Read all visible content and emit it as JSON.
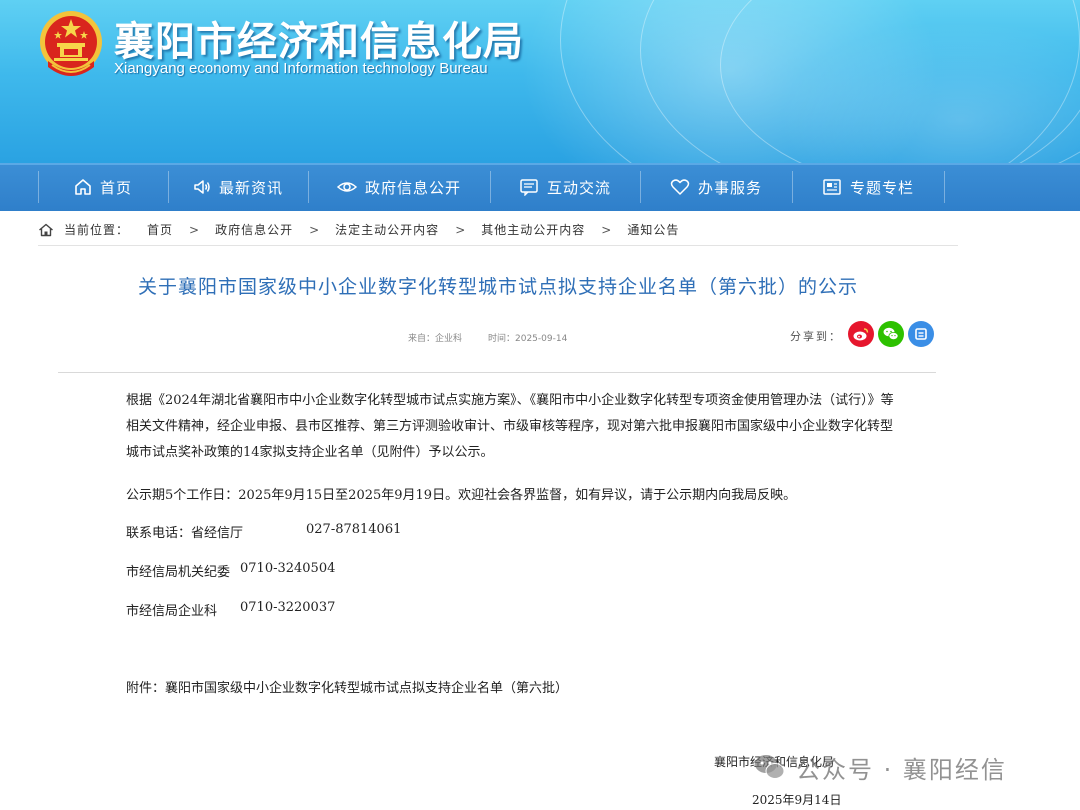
{
  "header": {
    "title": "襄阳市经济和信息化局",
    "subtitle": "Xiangyang economy and Information technology Bureau"
  },
  "nav": [
    {
      "label": "首页",
      "icon": "home-icon"
    },
    {
      "label": "最新资讯",
      "icon": "speaker-icon"
    },
    {
      "label": "政府信息公开",
      "icon": "eye-icon"
    },
    {
      "label": "互动交流",
      "icon": "message-icon"
    },
    {
      "label": "办事服务",
      "icon": "heart-icon"
    },
    {
      "label": "专题专栏",
      "icon": "newspaper-icon"
    }
  ],
  "breadcrumb": {
    "prefix": "当前位置：",
    "items": [
      "首页",
      "政府信息公开",
      "法定主动公开内容",
      "其他主动公开内容",
      "通知公告"
    ],
    "separator": ">"
  },
  "article": {
    "title": "关于襄阳市国家级中小企业数字化转型城市试点拟支持企业名单（第六批）的公示",
    "source": "来自：企业科",
    "time": "时间：2025-09-14",
    "share_label": "分享到：",
    "share_icons": [
      "weibo-icon",
      "wechat-icon",
      "qzone-icon"
    ],
    "paragraph": "根据《2024年湖北省襄阳市中小企业数字化转型城市试点实施方案》、《襄阳市中小企业数字化转型专项资金使用管理办法（试行）》等相关文件精神，经企业申报、县市区推荐、第三方评测验收审计、市级审核等程序，现对第六批申报襄阳市国家级中小企业数字化转型城市试点奖补政策的14家拟支持企业名单（见附件）予以公示。",
    "period": "公示期5个工作日：2025年9月15日至2025年9月19日。欢迎社会各界监督，如有异议，请于公示期内向我局反映。",
    "contacts": [
      {
        "label": "联系电话：省经信厅",
        "phone": "027-87814061"
      },
      {
        "label": "市经信局机关纪委",
        "phone": "0710-3240504"
      },
      {
        "label": "市经信局企业科",
        "phone": "0710-3220037"
      }
    ],
    "attachment": "附件：襄阳市国家级中小企业数字化转型城市试点拟支持企业名单（第六批）",
    "signature": "襄阳市经济和信息化局",
    "date": "2025年9月14日"
  },
  "watermark": {
    "text": "公众号 · 襄阳经信"
  },
  "colors": {
    "banner": "#3fb9ec",
    "nav": "#2f7fca",
    "title": "#2f6fb7",
    "weibo": "#e6162d",
    "wechat": "#2dc100",
    "qzone": "#3a8ee6"
  }
}
